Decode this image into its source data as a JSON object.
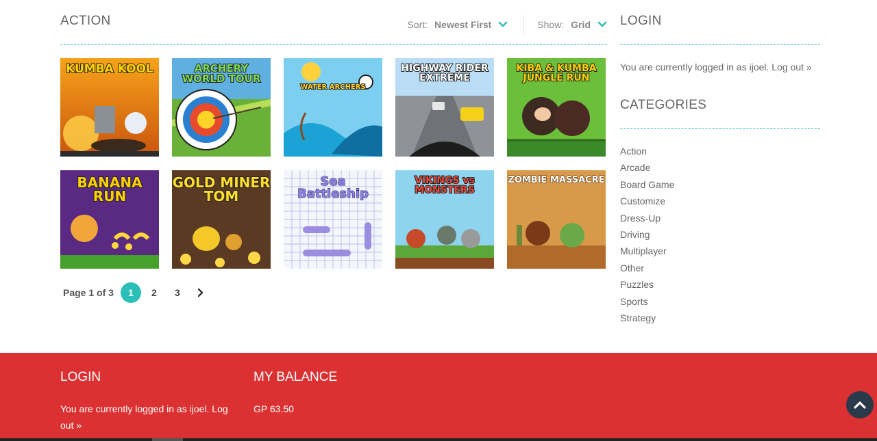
{
  "main": {
    "title": "ACTION",
    "sort": {
      "label": "Sort:",
      "value": "Newest First"
    },
    "show": {
      "label": "Show:",
      "value": "Grid"
    },
    "games": [
      {
        "title": "KUMBA KOOL"
      },
      {
        "title": "ARCHERY WORLD TOUR"
      },
      {
        "title": "WATER ARCHERS"
      },
      {
        "title": "HIGHWAY RIDER EXTREME"
      },
      {
        "title": "KIBA & KUMBA JUNGLE RUN"
      },
      {
        "title": "BANANA RUN"
      },
      {
        "title": "GOLD MINER TOM"
      },
      {
        "title": "Sea Battleship"
      },
      {
        "title": "VIKINGS vs MONSTERS"
      },
      {
        "title": "ZOMBIE MASSACRE"
      }
    ],
    "pagination": {
      "info": "Page 1 of 3",
      "pages": [
        "1",
        "2",
        "3"
      ],
      "current": "1"
    }
  },
  "sidebar": {
    "login": {
      "title": "LOGIN",
      "text": "You are currently logged in as ijoel.",
      "logout": "Log out »"
    },
    "categories": {
      "title": "CATEGORIES",
      "items": [
        "Action",
        "Arcade",
        "Board Game",
        "Customize",
        "Dress-Up",
        "Driving",
        "Multiplayer",
        "Other",
        "Puzzles",
        "Sports",
        "Strategy"
      ]
    }
  },
  "footer": {
    "login": {
      "title": "LOGIN",
      "text": "You are currently logged in as ijoel.",
      "logout": "Log out »"
    },
    "balance": {
      "title": "MY BALANCE",
      "value": "GP 63.50"
    }
  },
  "colors": {
    "accent": "#2bbfb8",
    "footer": "#db3132",
    "back_to_top": "#2b3a4a"
  },
  "icons": {
    "sort_toggle": "chevron-down-icon",
    "show_toggle": "chevron-down-icon",
    "next_page": "chevron-right-icon",
    "back_to_top": "chevron-up-icon"
  }
}
